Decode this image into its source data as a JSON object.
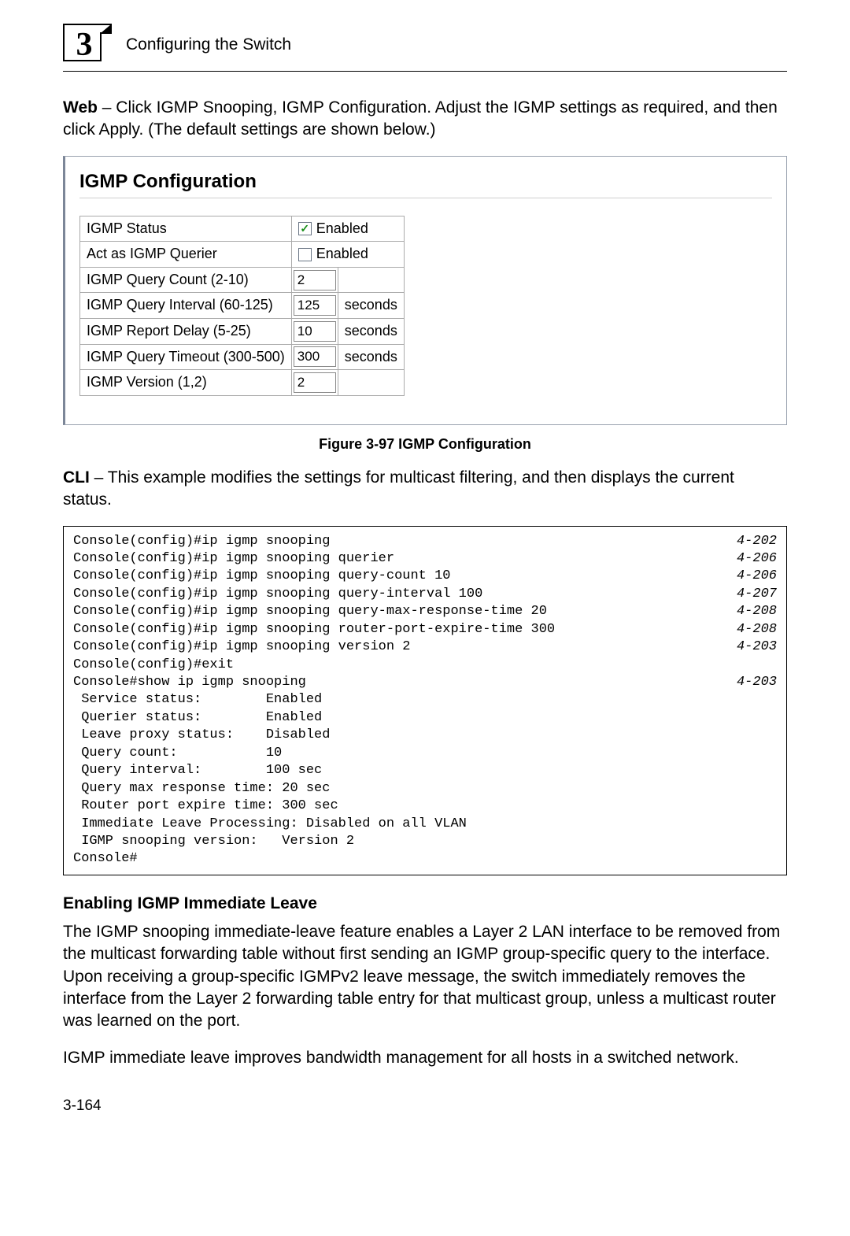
{
  "header": {
    "chapter_number": "3",
    "section_title": "Configuring the Switch"
  },
  "intro": {
    "lead_bold": "Web",
    "lead_rest": " – Click IGMP Snooping, IGMP Configuration. Adjust the IGMP settings as required, and then click Apply. (The default settings are shown below.)"
  },
  "figure": {
    "panel_title": "IGMP Configuration",
    "rows": {
      "status_label": "IGMP Status",
      "status_checkbox_label": "Enabled",
      "querier_label": "Act as IGMP Querier",
      "querier_checkbox_label": "Enabled",
      "query_count_label": "IGMP Query Count (2-10)",
      "query_count_value": "2",
      "query_interval_label": "IGMP Query Interval (60-125)",
      "query_interval_value": "125",
      "report_delay_label": "IGMP Report Delay (5-25)",
      "report_delay_value": "10",
      "query_timeout_label": "IGMP Query Timeout (300-500)",
      "query_timeout_value": "300",
      "version_label": "IGMP Version (1,2)",
      "version_value": "2",
      "seconds": "seconds"
    },
    "caption": "Figure 3-97  IGMP Configuration"
  },
  "cli_intro": {
    "lead_bold": "CLI",
    "lead_rest": " – This example modifies the settings for multicast filtering, and then displays the current status."
  },
  "cli": {
    "lines": [
      {
        "t": "Console(config)#ip igmp snooping",
        "r": "4-202"
      },
      {
        "t": "Console(config)#ip igmp snooping querier",
        "r": "4-206"
      },
      {
        "t": "Console(config)#ip igmp snooping query-count 10",
        "r": "4-206"
      },
      {
        "t": "Console(config)#ip igmp snooping query-interval 100",
        "r": "4-207"
      },
      {
        "t": "Console(config)#ip igmp snooping query-max-response-time 20",
        "r": "4-208"
      },
      {
        "t": "Console(config)#ip igmp snooping router-port-expire-time 300",
        "r": "4-208"
      },
      {
        "t": "Console(config)#ip igmp snooping version 2",
        "r": "4-203"
      },
      {
        "t": "Console(config)#exit",
        "r": ""
      },
      {
        "t": "Console#show ip igmp snooping",
        "r": "4-203"
      },
      {
        "t": " Service status:        Enabled",
        "r": ""
      },
      {
        "t": " Querier status:        Enabled",
        "r": ""
      },
      {
        "t": " Leave proxy status:    Disabled",
        "r": ""
      },
      {
        "t": " Query count:           10",
        "r": ""
      },
      {
        "t": " Query interval:        100 sec",
        "r": ""
      },
      {
        "t": " Query max response time: 20 sec",
        "r": ""
      },
      {
        "t": " Router port expire time: 300 sec",
        "r": ""
      },
      {
        "t": " Immediate Leave Processing: Disabled on all VLAN",
        "r": ""
      },
      {
        "t": " IGMP snooping version:   Version 2",
        "r": ""
      },
      {
        "t": "Console#",
        "r": ""
      }
    ]
  },
  "subsection": {
    "title": "Enabling IGMP Immediate Leave",
    "para1": "The IGMP snooping immediate-leave feature enables a Layer 2 LAN interface to be removed from the multicast forwarding table without first sending an IGMP group-specific query to the interface. Upon receiving a group-specific IGMPv2 leave message, the switch immediately removes the interface from the Layer 2 forwarding table entry for that multicast group, unless a multicast router was learned on the port.",
    "para2": "IGMP immediate leave improves bandwidth management for all hosts in a switched network."
  },
  "page_number": "3-164"
}
